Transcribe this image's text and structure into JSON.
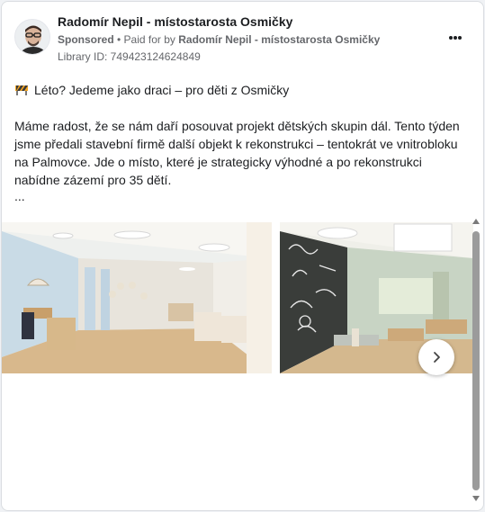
{
  "header": {
    "advertiser_name": "Radomír Nepil - místostarosta Osmičky",
    "sponsored_label": "Sponsored",
    "separator": " • ",
    "paid_for_prefix": "Paid for by ",
    "paid_for_by": "Radomír Nepil - místostarosta Osmičky",
    "library_id": "Library ID: 749423124624849",
    "more_icon": "ellipsis-icon"
  },
  "post": {
    "headline_icon": "construction-barrier-icon",
    "headline": "Léto? Jedeme jako draci – pro děti z Osmičky",
    "paragraph": "Máme radost, že se nám daří posouvat projekt dětských skupin dál. Tento týden jsme předali stavební firmě další objekt k rekonstrukci – tentokrát ve vnitrobloku na Palmovce. Jde o místo, které je strategicky výhodné a po rekonstrukci nabídne zázemí pro 35 dětí.",
    "ellipsis": "..."
  },
  "carousel": {
    "next_icon": "chevron-right-icon"
  }
}
